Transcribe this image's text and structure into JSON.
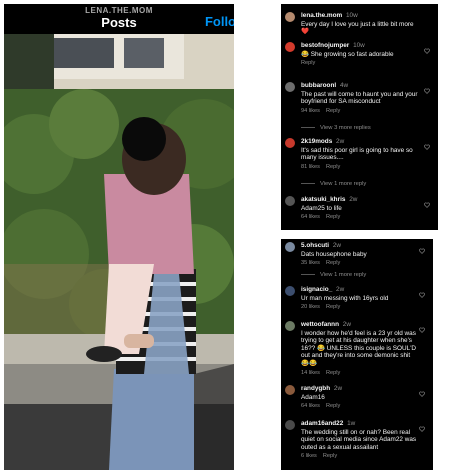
{
  "post": {
    "username": "LENA.THE.MOM",
    "title": "Posts",
    "follow_label": "Follo"
  },
  "comments_top": [
    {
      "user": "lena.the.mom",
      "time": "10w",
      "text": "Every day I love you just a little bit more ❤️",
      "likes": "",
      "reply": "",
      "replies": "",
      "avatar": "#b58a6e"
    },
    {
      "user": "bestofnojumper",
      "time": "10w",
      "text": "😂 She growing so fast adorable",
      "likes": "",
      "reply": "Reply",
      "replies": "",
      "avatar": "#d33b2c"
    },
    {
      "user": "bubbaroonl",
      "time": "4w",
      "text": "The past will come to haunt you and your boyfriend for SA misconduct",
      "likes": "94 likes",
      "reply": "Reply",
      "replies": "View 3 more replies",
      "avatar": "#6d6d6d"
    },
    {
      "user": "2k19mods",
      "time": "2w",
      "text": "It's sad this poor girl is going to have so many issues....",
      "likes": "81 likes",
      "reply": "Reply",
      "replies": "View 1 more reply",
      "avatar": "#c7392c"
    },
    {
      "user": "akatsuki_khris",
      "time": "2w",
      "text": "Adam25 to life",
      "likes": "64 likes",
      "reply": "Reply",
      "replies": "",
      "avatar": "#555555"
    }
  ],
  "comments_bottom": [
    {
      "user": "5.ohscuti",
      "time": "2w",
      "text": "Dats housephone baby",
      "likes": "35 likes",
      "reply": "Reply",
      "replies": "View 1 more reply",
      "avatar": "#7a8aa0"
    },
    {
      "user": "isignacio_",
      "time": "2w",
      "text": "Ur man messing with 16yrs old",
      "likes": "20 likes",
      "reply": "Reply",
      "replies": "",
      "avatar": "#3c4e6e"
    },
    {
      "user": "wettoofannn",
      "time": "2w",
      "text": "I wonder how he'd feel is a 23 yr old was trying to get at his daughter when she's 16?? 😂 UNLESS this couple is SOUL'D out and they're into some demonic shit 😂😂",
      "likes": "14 likes",
      "reply": "Reply",
      "replies": "",
      "avatar": "#6c7b64"
    },
    {
      "user": "randygbh",
      "time": "2w",
      "text": "Adam16",
      "likes": "64 likes",
      "reply": "Reply",
      "replies": "",
      "avatar": "#8a5a3c"
    },
    {
      "user": "adam16and22",
      "time": "1w",
      "text": "The wedding still on or nah? Been real quiet on social media since Adam22 was outed as a sexual assailant",
      "likes": "6 likes",
      "reply": "Reply",
      "replies": "",
      "avatar": "#4a4a4a"
    }
  ],
  "icons": {
    "heart": "heart-outline-icon"
  },
  "colors": {
    "accent": "#0095f6",
    "background": "#000000",
    "muted": "#8e8e8e"
  }
}
